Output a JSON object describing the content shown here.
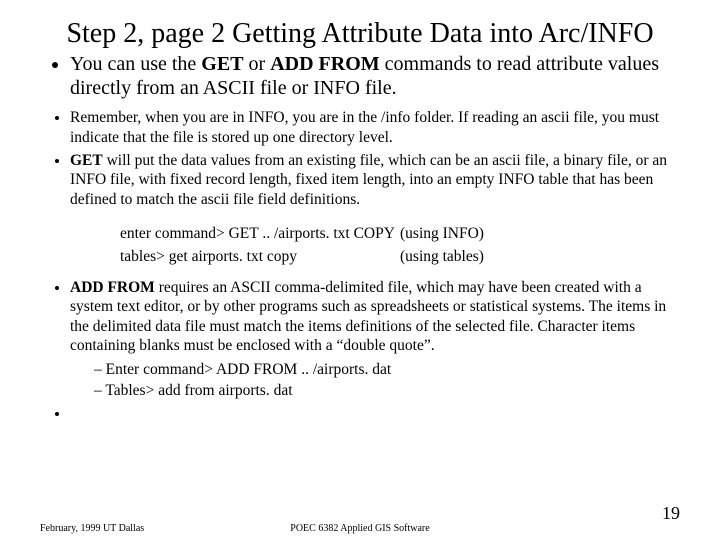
{
  "title": "Step 2, page 2 Getting Attribute Data into Arc/INFO",
  "bullet1_pre": "You can use the ",
  "bullet1_b1": "GET",
  "bullet1_mid": " or ",
  "bullet1_b2": "ADD FROM",
  "bullet1_post": " commands to read attribute values directly from an ASCII file or INFO file.",
  "bullet2": "Remember, when you are in INFO, you are in the /info folder. If reading an ascii file, you must indicate that the file is stored up one directory level.",
  "bullet3_b": "GET",
  "bullet3_post": " will put the data values from an existing file, which can be an ascii file, a binary file, or an INFO file, with fixed record length, fixed item length, into an empty INFO table that has been defined to match the ascii file field definitions.",
  "cmd1_left": "enter command>  GET .. /airports. txt  COPY",
  "cmd1_right": "(using INFO)",
  "cmd2_left": "tables>  get airports. txt copy",
  "cmd2_right": "(using tables)",
  "bullet4_b": "ADD FROM",
  "bullet4_post": " requires an ASCII comma-delimited file, which may have been created with a system text editor, or by other programs such as spreadsheets or statistical systems.  The items in the delimited data file must match the items definitions of the selected file. Character items containing blanks must be enclosed with a “double quote”.",
  "sub1": "Enter command> ADD FROM .. /airports. dat",
  "sub2": "Tables> add from airports. dat",
  "footer_left": "February, 1999  UT Dallas",
  "footer_center": "POEC 6382 Applied GIS Software",
  "page_number": "19"
}
